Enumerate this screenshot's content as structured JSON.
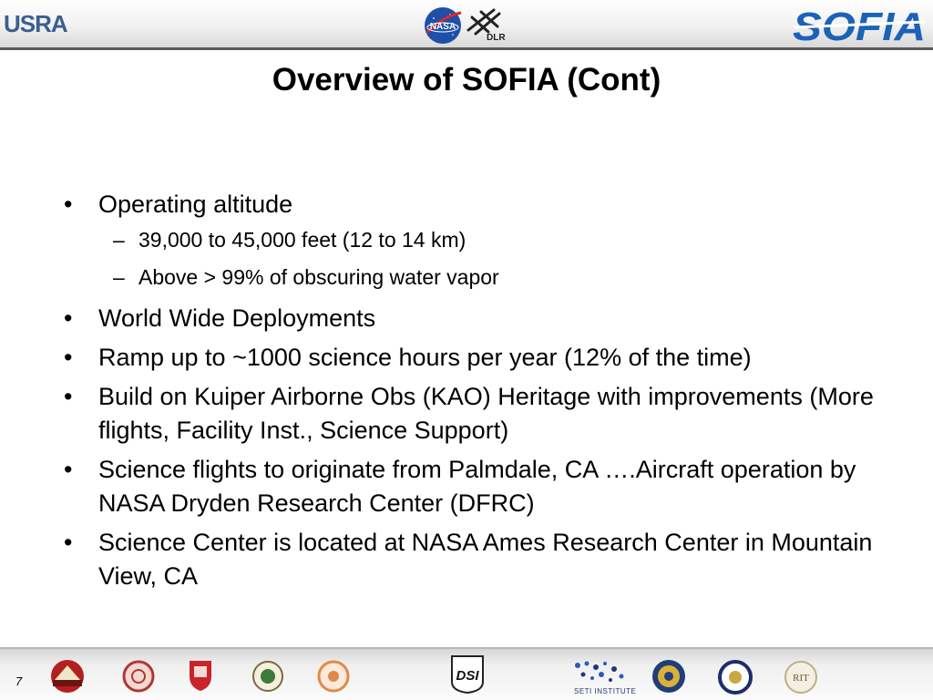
{
  "header": {
    "usra_logo_text": "USRA",
    "nasa_logo_text": "NASA",
    "dlr_logo_text": "DLR",
    "sofia_logo_text": "SOFIA"
  },
  "slide": {
    "title": "Overview of SOFIA (Cont)",
    "bullets": [
      {
        "text": "Operating altitude",
        "sub": [
          "39,000 to 45,000 feet (12 to 14 km)",
          "Above > 99% of obscuring water vapor"
        ]
      },
      {
        "text": "World Wide Deployments"
      },
      {
        "text": "Ramp up to ~1000 science hours per year (12% of the time)"
      },
      {
        "text": "Build on Kuiper Airborne Obs (KAO) Heritage with improvements (More flights, Facility Inst., Science Support)"
      },
      {
        "text": "Science flights to originate from Palmdale, CA ….Aircraft operation by NASA Dryden Research Center (DFRC)"
      },
      {
        "text": "Science Center is located at NASA Ames Research Center in Mountain View, CA"
      }
    ],
    "bullet_marker": "•",
    "sub_marker": "–"
  },
  "footer": {
    "page_number": "7",
    "dsi_logo_text": "DSI",
    "seti_logo_text": "SETI INSTITUTE",
    "rit_logo_text": "RIT"
  },
  "colors": {
    "usra_blue": "#3a5f8f",
    "nasa_blue": "#1f4fa8",
    "nasa_red": "#d62a2a",
    "sofia_blue": "#1b62b8",
    "rule_gray": "#5a5a5a"
  }
}
